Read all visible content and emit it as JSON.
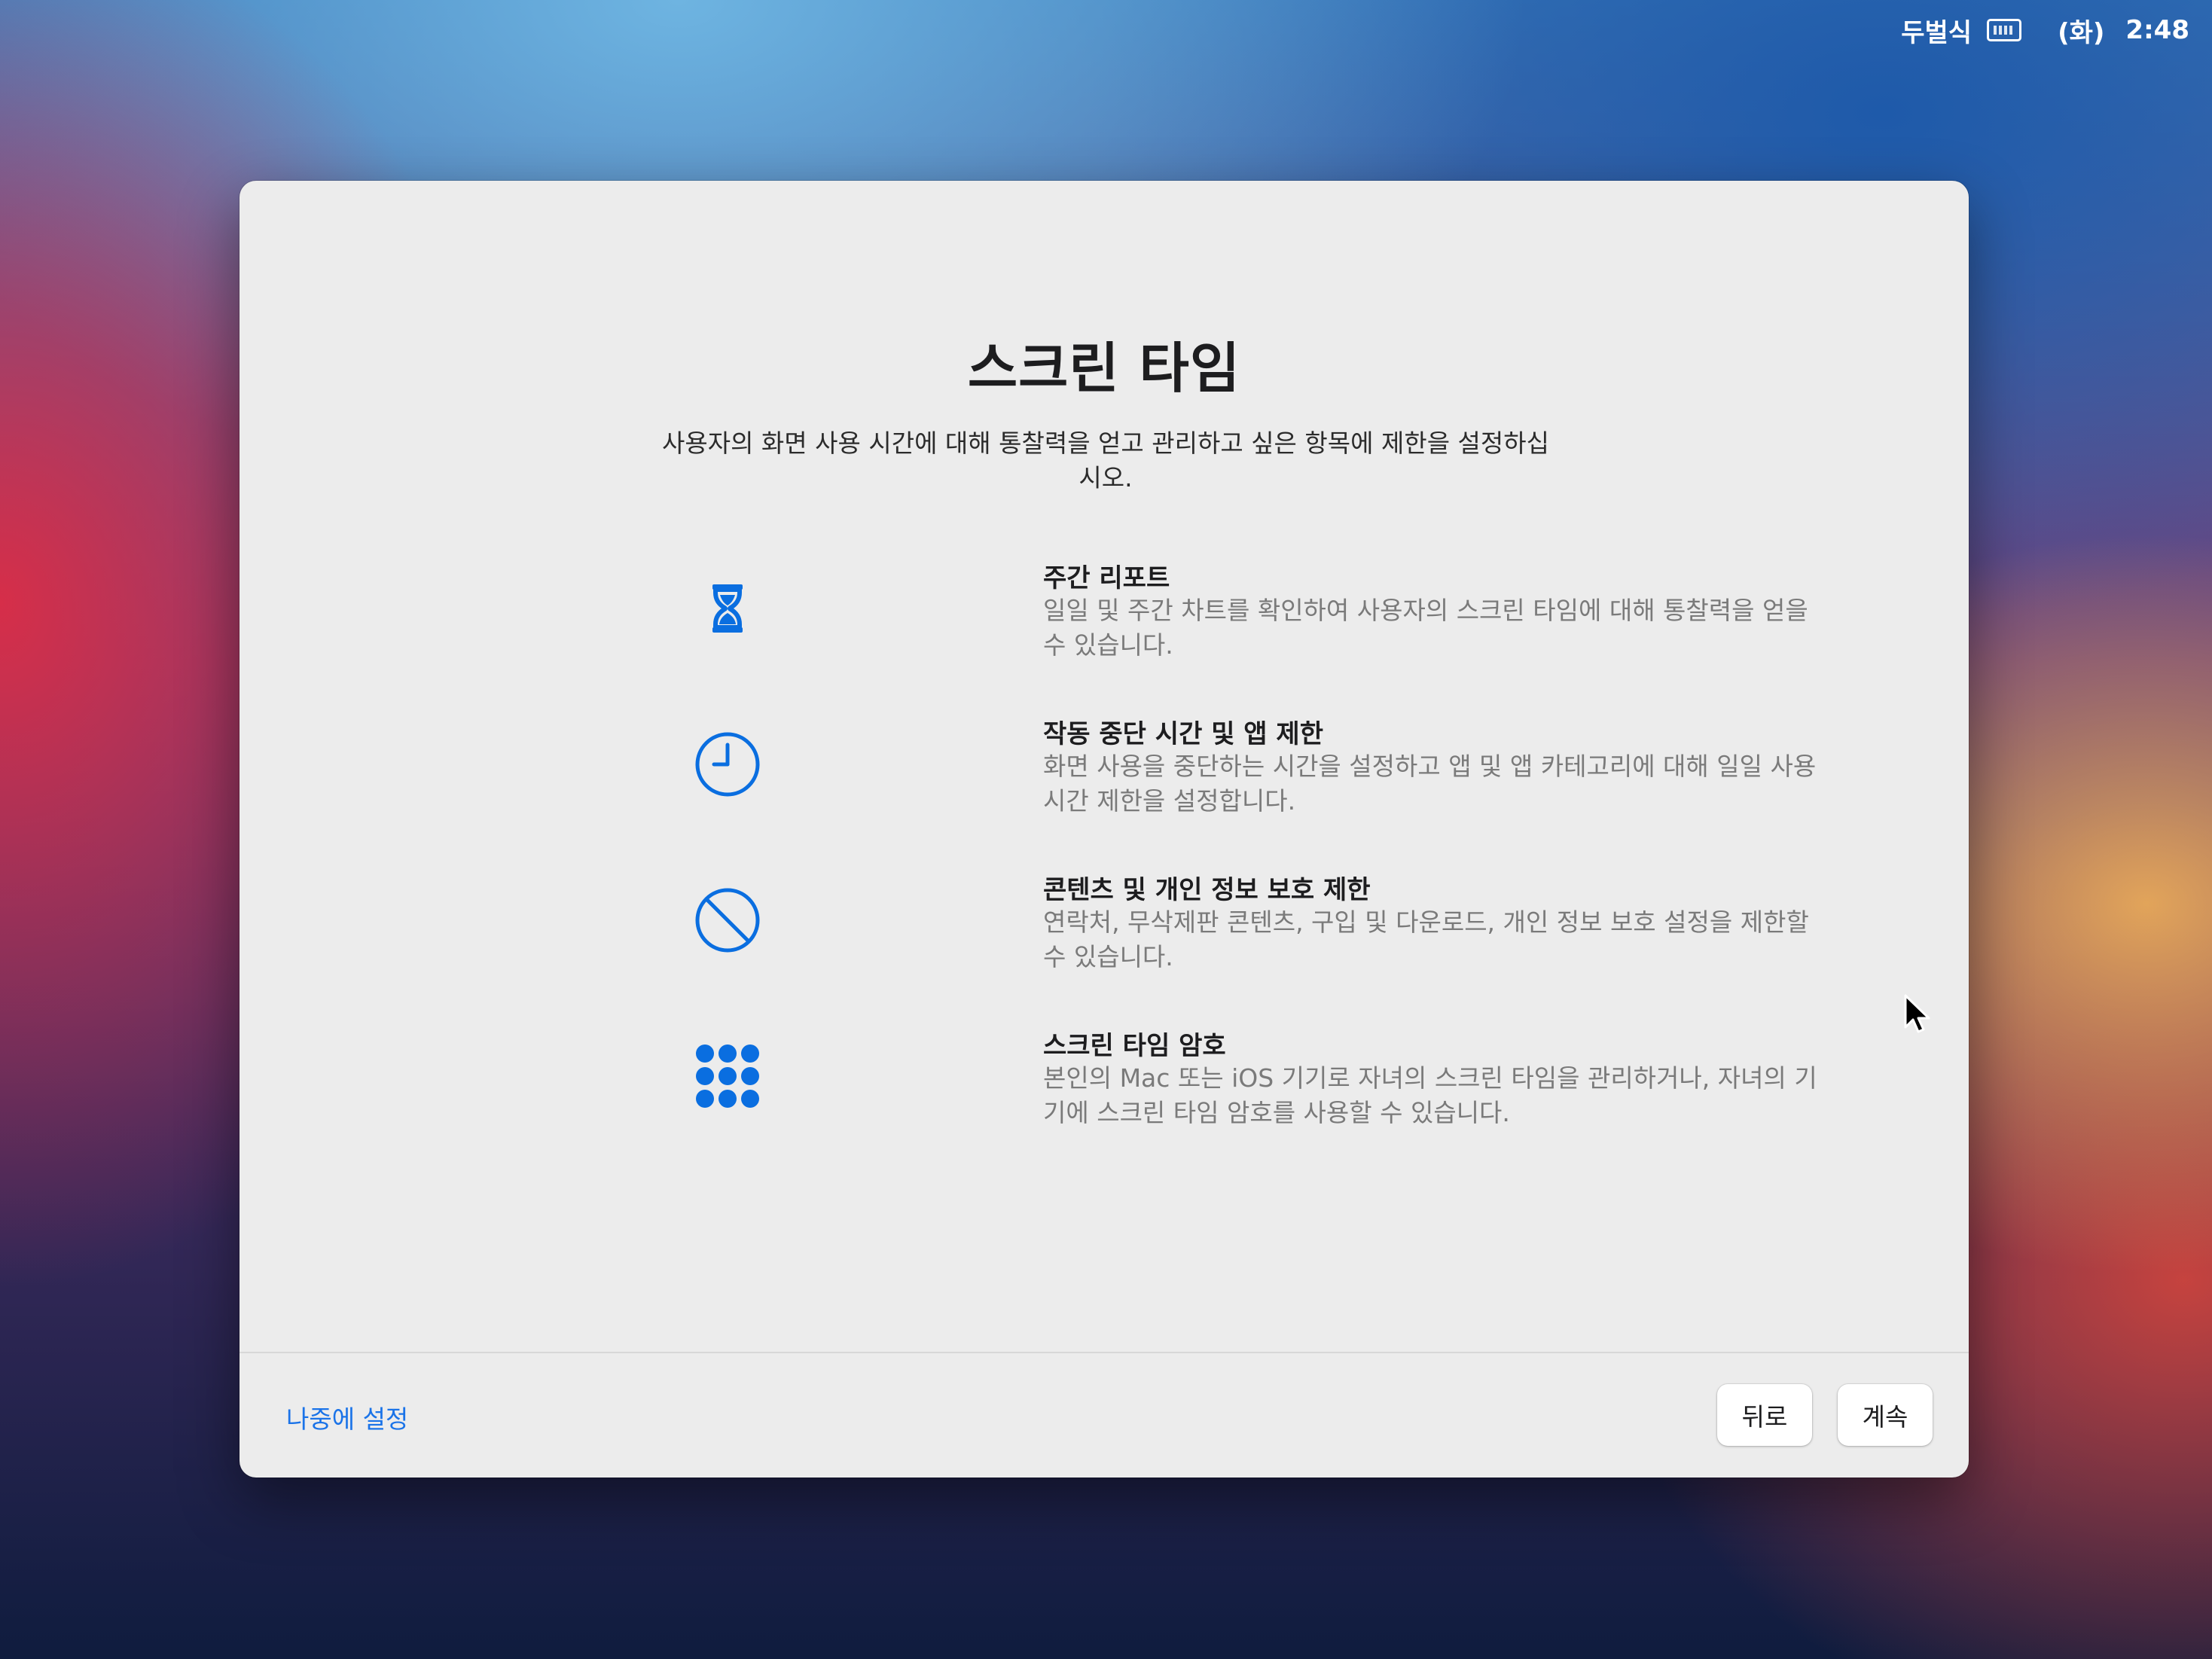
{
  "menubar": {
    "input_method": "두벌식",
    "day": "(화)",
    "time": "2:48"
  },
  "dialog": {
    "title": "스크린 타임",
    "subtitle": "사용자의 화면 사용 시간에 대해 통찰력을 얻고 관리하고 싶은 항목에 제한을 설정하십시오.",
    "features": [
      {
        "icon": "hourglass-icon",
        "title": "주간 리포트",
        "description": "일일 및 주간 차트를 확인하여 사용자의 스크린 타임에 대해 통찰력을 얻을 수 있습니다."
      },
      {
        "icon": "clock-icon",
        "title": "작동 중단 시간 및 앱 제한",
        "description": "화면 사용을 중단하는 시간을 설정하고 앱 및 앱 카테고리에 대해 일일 사용 시간 제한을 설정합니다."
      },
      {
        "icon": "prohibited-icon",
        "title": "콘텐츠 및 개인 정보 보호 제한",
        "description": "연락처, 무삭제판 콘텐츠, 구입 및 다운로드, 개인 정보 보호 설정을 제한할 수 있습니다."
      },
      {
        "icon": "keypad-icon",
        "title": "스크린 타임 암호",
        "description": "본인의 Mac 또는 iOS 기기로 자녀의 스크린 타임을 관리하거나, 자녀의 기기에 스크린 타임 암호를 사용할 수 있습니다."
      }
    ],
    "setup_later_label": "나중에 설정",
    "back_label": "뒤로",
    "continue_label": "계속"
  },
  "colors": {
    "accent": "#1a73e8",
    "icon_blue": "#0a6ee0"
  }
}
